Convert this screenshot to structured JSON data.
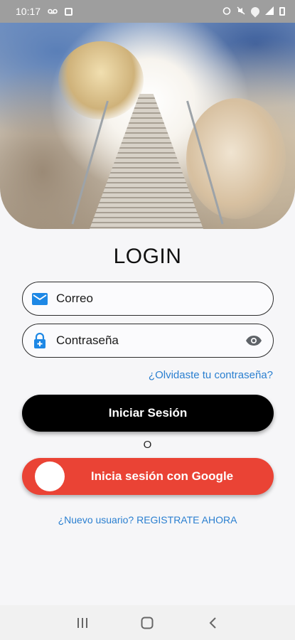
{
  "status_bar": {
    "time": "10:17",
    "left_icons": [
      "voicemail-icon",
      "message-icon"
    ],
    "right_icons": [
      "alarm-icon",
      "mute-icon",
      "wifi-icon",
      "signal-icon",
      "battery-icon"
    ]
  },
  "hero": {
    "description_icon": "stairway-to-heaven-image"
  },
  "login": {
    "title": "LOGIN",
    "email": {
      "placeholder": "Correo",
      "icon": "email-icon"
    },
    "password": {
      "placeholder": "Contraseña",
      "icon": "lock-icon",
      "toggle_icon": "eye-icon"
    },
    "forgot_link": "¿Olvidaste tu contraseña?",
    "submit_label": "Iniciar Sesión",
    "separator": "O",
    "google_label": "Inicia sesión con Google",
    "register_link": "¿Nuevo usuario? REGISTRATE AHORA"
  },
  "colors": {
    "accent": "#2a7fd0",
    "google_red": "#ea4335",
    "primary_button": "#000000",
    "icon_blue": "#1e88e5"
  },
  "nav_bar": {
    "buttons": [
      "recents-icon",
      "home-icon",
      "back-icon"
    ]
  }
}
